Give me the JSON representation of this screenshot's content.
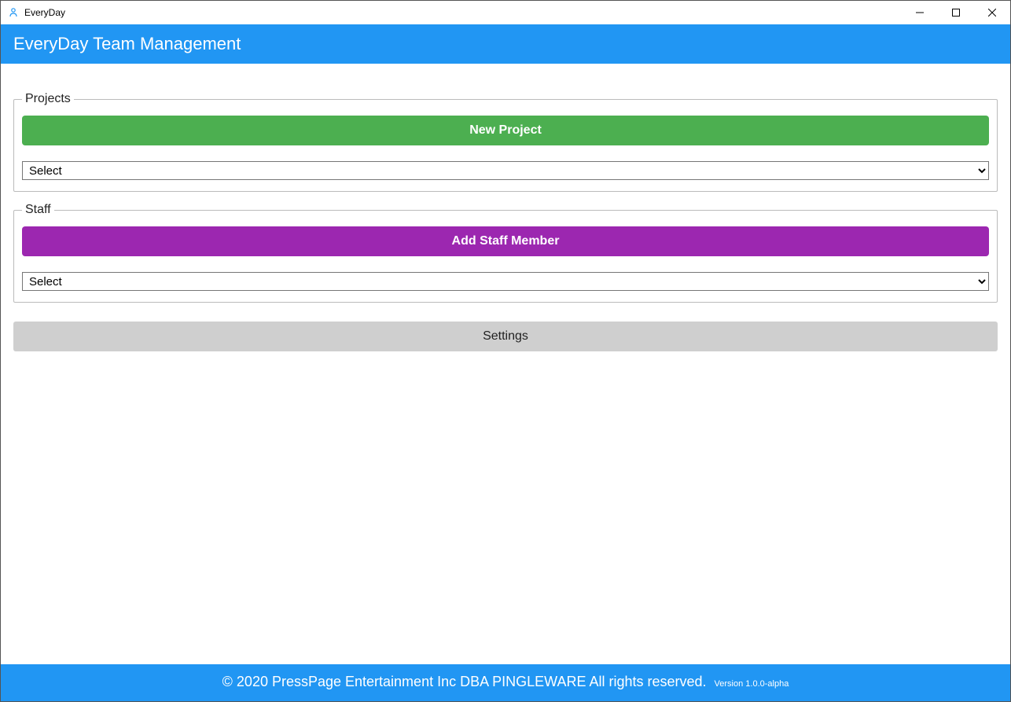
{
  "window": {
    "title": "EveryDay"
  },
  "header": {
    "title": "EveryDay Team Management"
  },
  "projects": {
    "legend": "Projects",
    "new_button": "New Project",
    "select_value": "Select"
  },
  "staff": {
    "legend": "Staff",
    "add_button": "Add Staff Member",
    "select_value": "Select"
  },
  "settings": {
    "label": "Settings"
  },
  "footer": {
    "copyright": "© 2020 PressPage Entertainment Inc DBA PINGLEWARE  All rights reserved.",
    "version": "Version 1.0.0-alpha"
  }
}
